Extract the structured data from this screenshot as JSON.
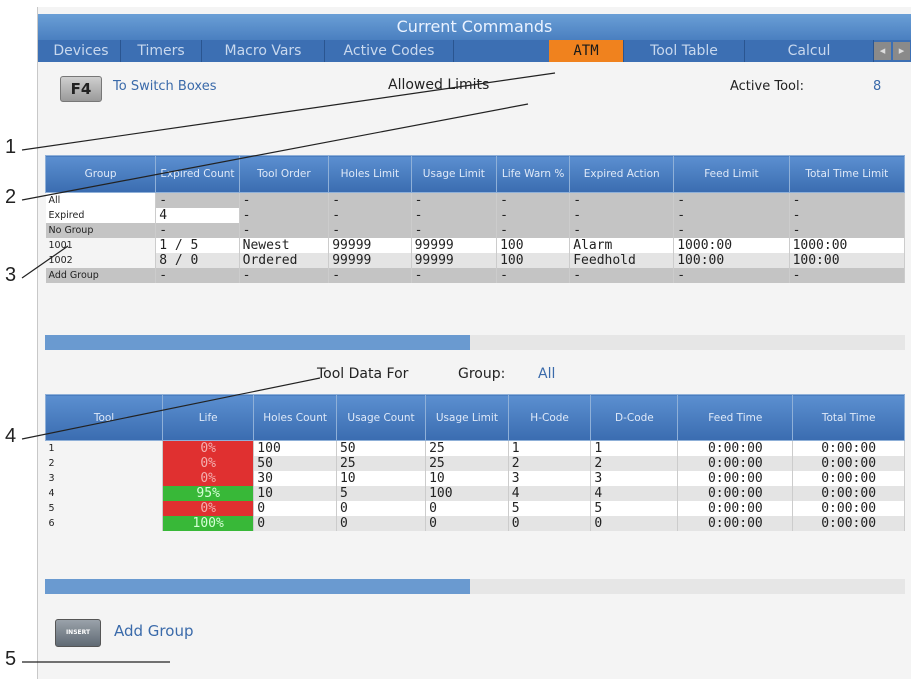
{
  "window": {
    "title": "Current Commands"
  },
  "tabs": [
    "Devices",
    "Timers",
    "Macro Vars",
    "Active Codes",
    "ATM",
    "Tool Table",
    "Calcul"
  ],
  "active_tab": "ATM",
  "header": {
    "f4_key": "F4",
    "switch_hint": "To Switch Boxes",
    "allowed_limits_title": "Allowed Limits",
    "active_tool_label": "Active Tool:",
    "active_tool_value": "8"
  },
  "limits_table": {
    "columns": [
      "Group",
      "Expired Count",
      "Tool Order",
      "Holes Limit",
      "Usage Limit",
      "Life Warn %",
      "Expired Action",
      "Feed Limit",
      "Total Time Limit"
    ],
    "rows": [
      [
        "All",
        "-",
        "-",
        "-",
        "-",
        "-",
        "-",
        "-",
        "-"
      ],
      [
        "Expired",
        "4",
        "-",
        "-",
        "-",
        "-",
        "-",
        "-",
        "-"
      ],
      [
        "No Group",
        "-",
        "-",
        "-",
        "-",
        "-",
        "-",
        "-",
        "-"
      ],
      [
        "1001",
        "1 / 5",
        "Newest",
        "99999",
        "99999",
        "100",
        "Alarm",
        "1000:00",
        "1000:00"
      ],
      [
        "1002",
        "8 / 0",
        "Ordered",
        "99999",
        "99999",
        "100",
        "Feedhold",
        "100:00",
        "100:00"
      ],
      [
        "Add Group",
        "-",
        "-",
        "-",
        "-",
        "-",
        "-",
        "-",
        "-"
      ]
    ]
  },
  "tool_data": {
    "title": "Tool Data For",
    "group_label": "Group:",
    "group_value": "All",
    "columns": [
      "Tool",
      "Life",
      "Holes Count",
      "Usage Count",
      "Usage Limit",
      "H-Code",
      "D-Code",
      "Feed Time",
      "Total Time"
    ],
    "rows": [
      [
        "1",
        "0%",
        "100",
        "50",
        "25",
        "1",
        "1",
        "0:00:00",
        "0:00:00"
      ],
      [
        "2",
        "0%",
        "50",
        "25",
        "25",
        "2",
        "2",
        "0:00:00",
        "0:00:00"
      ],
      [
        "3",
        "0%",
        "30",
        "10",
        "10",
        "3",
        "3",
        "0:00:00",
        "0:00:00"
      ],
      [
        "4",
        "95%",
        "10",
        "5",
        "100",
        "4",
        "4",
        "0:00:00",
        "0:00:00"
      ],
      [
        "5",
        "0%",
        "0",
        "0",
        "0",
        "5",
        "5",
        "0:00:00",
        "0:00:00"
      ],
      [
        "6",
        "100%",
        "0",
        "0",
        "0",
        "0",
        "0",
        "0:00:00",
        "0:00:00"
      ]
    ],
    "life_status": [
      "red",
      "red",
      "red",
      "green",
      "red",
      "green"
    ]
  },
  "footer": {
    "insert_key": "INSERT",
    "add_group": "Add Group"
  },
  "callouts": [
    "1",
    "2",
    "3",
    "4",
    "5"
  ],
  "colors": {
    "accent": "#f0821e",
    "header_blue": "#3a6cb0",
    "life_red": "#e03030",
    "life_green": "#38b838",
    "link_blue": "#3a6aaa"
  }
}
